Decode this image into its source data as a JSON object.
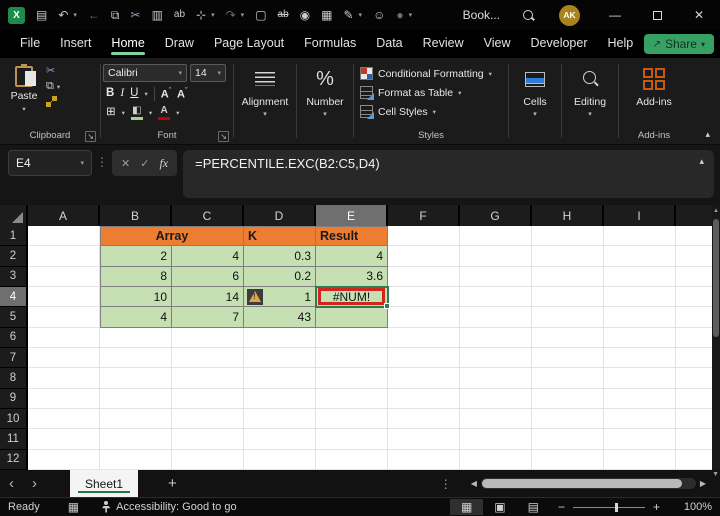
{
  "titlebar": {
    "document_title": "Book...",
    "avatar_initials": "AK"
  },
  "icons": {
    "save": "▤",
    "undo": "↶",
    "back": "←",
    "copy": "⧉",
    "cut": "✂",
    "paste_special": "▥",
    "replace": "ab",
    "touch": "⊹",
    "redo": "↷",
    "new_file": "▢",
    "strike_ab": "ab",
    "camera": "◉",
    "sheet_view": "▦",
    "export": "✎",
    "person": "☺",
    "record": "●",
    "chev_down": "▾",
    "chev_up": "▴",
    "launcher": "↘",
    "cancel": "✕",
    "check": "✓",
    "minimize": "—",
    "close": "✕",
    "borders": "⊞",
    "fill": "◧",
    "share_arrow": "↗",
    "left": "◀",
    "right": "▶",
    "up": "▲",
    "down": "▼",
    "dots_v": "⋮",
    "prev": "‹",
    "next": "›",
    "plus": "+",
    "minus": "−",
    "warning": "!",
    "grid_view": "▦",
    "page_layout": "▣",
    "page_break": "▤",
    "grow_mark": "ˆ",
    "shrink_mark": "ˇ",
    "logo": "X"
  },
  "ribbon": {
    "tabs": [
      "File",
      "Insert",
      "Home",
      "Draw",
      "Page Layout",
      "Formulas",
      "Data",
      "Review",
      "View",
      "Developer",
      "Help"
    ],
    "share": "Share",
    "clipboard": {
      "paste": "Paste",
      "label": "Clipboard"
    },
    "font": {
      "name": "Calibri",
      "size": "14",
      "bold": "B",
      "italic": "I",
      "underline": "U",
      "grow": "A",
      "shrink": "A",
      "label": "Font"
    },
    "alignment": {
      "title": "Alignment"
    },
    "number": {
      "title": "Number",
      "percent": "%"
    },
    "styles": {
      "cf": "Conditional Formatting",
      "fat": "Format as Table",
      "cs": "Cell Styles",
      "label": "Styles"
    },
    "cells": {
      "title": "Cells"
    },
    "editing": {
      "title": "Editing"
    },
    "addins": {
      "title": "Add-ins",
      "label": "Add-ins"
    }
  },
  "formula_bar": {
    "name_box": "E4",
    "fx": "fx",
    "formula": "=PERCENTILE.EXC(B2:C5,D4)"
  },
  "grid": {
    "columns": [
      "A",
      "B",
      "C",
      "D",
      "E",
      "F",
      "G",
      "H",
      "I"
    ],
    "selected_column": "E",
    "selected_row": "4",
    "rows": [
      "1",
      "2",
      "3",
      "4",
      "5",
      "6",
      "7",
      "8",
      "9",
      "10",
      "11",
      "12"
    ],
    "table": {
      "header": {
        "array": "Array",
        "k": "K",
        "result": "Result"
      },
      "data": [
        {
          "b": "2",
          "c": "4",
          "d": "0.3",
          "e": "4"
        },
        {
          "b": "8",
          "c": "6",
          "d": "0.2",
          "e": "3.6"
        },
        {
          "b": "10",
          "c": "14",
          "d": "1",
          "e": "#NUM!"
        },
        {
          "b": "4",
          "c": "7",
          "d": "43",
          "e": ""
        }
      ]
    }
  },
  "sheet_bar": {
    "active_tab": "Sheet1"
  },
  "status_bar": {
    "mode": "Ready",
    "accessibility": "Accessibility: Good to go",
    "zoom": "100%"
  },
  "colors": {
    "accent_green": "#21A366",
    "header_orange": "#ED7D31",
    "cell_green": "#C6E0B4",
    "error_red": "#D0261D",
    "selection_green": "#2E7D4F",
    "avatar_gold": "#A9841C"
  }
}
